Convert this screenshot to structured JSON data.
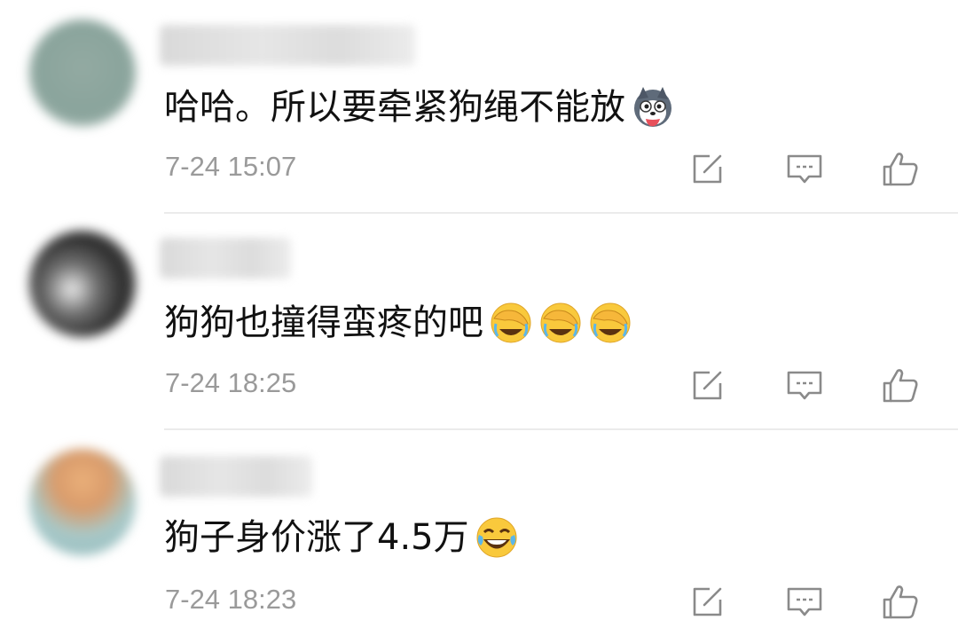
{
  "comments": [
    {
      "username": "██████████████",
      "text": "哈哈。所以要牵紧狗绳不能放",
      "emojis": [
        "husky-emoji"
      ],
      "time": "7-24 15:07"
    },
    {
      "username": "███████",
      "text": "狗狗也撞得蛮疼的吧",
      "emojis": [
        "facepalm-laugh-emoji",
        "facepalm-laugh-emoji",
        "facepalm-laugh-emoji"
      ],
      "time": "7-24 18:25"
    },
    {
      "username": "████████",
      "text": "狗子身价涨了4.5万",
      "emojis": [
        "laugh-tears-emoji"
      ],
      "time": "7-24 18:23"
    }
  ],
  "actions": {
    "share_icon": "edit-share-icon",
    "reply_icon": "comment-bubble-icon",
    "like_icon": "thumbs-up-icon"
  },
  "colors": {
    "timestamp": "#9a9a9a",
    "text": "#111111",
    "divider": "#ebebeb",
    "icon": "#8a8a8a"
  }
}
